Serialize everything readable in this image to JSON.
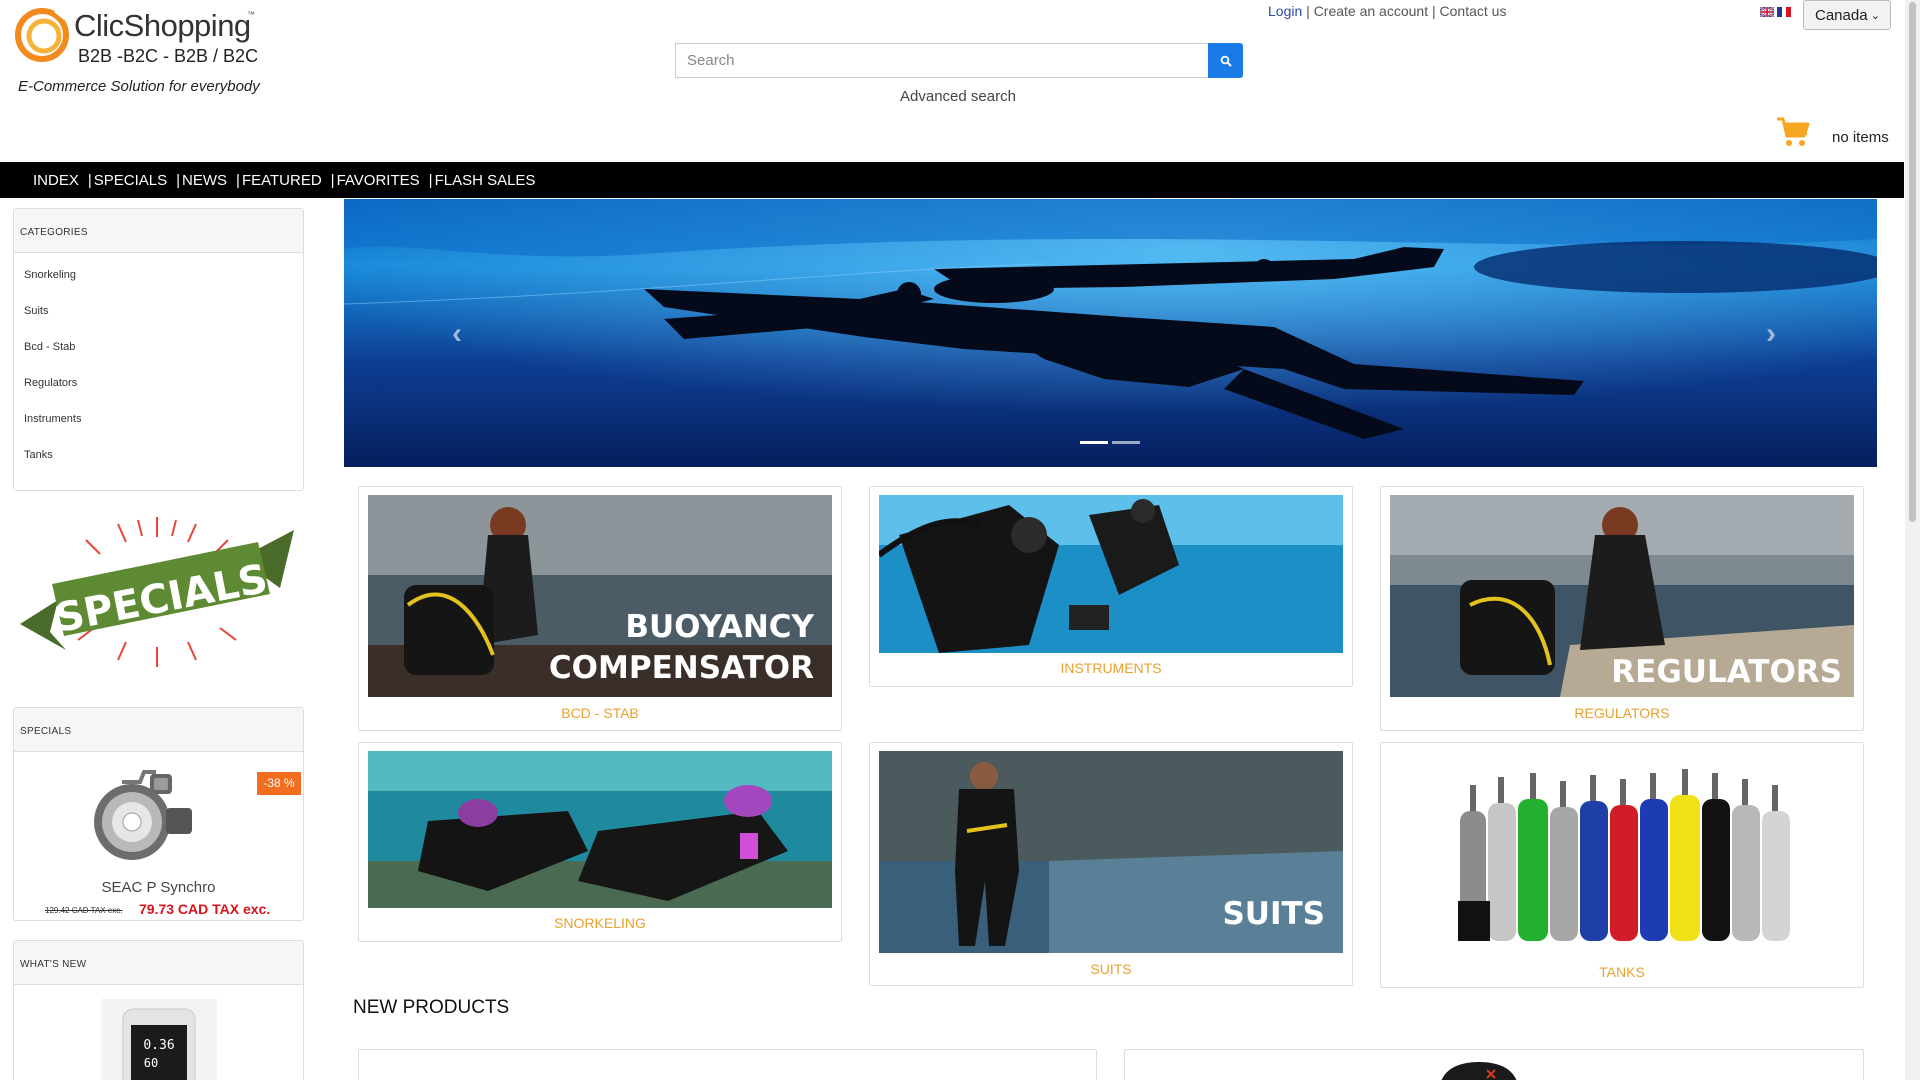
{
  "header": {
    "brand_name": "ClicShopping",
    "brand_tm": "™",
    "brand_subtitle": "B2B -B2C - B2B / B2C",
    "brand_tagline": "E-Commerce Solution for everybody",
    "login_label": "Login",
    "create_account_label": "Create an account",
    "contact_label": "Contact us",
    "separator": " | ",
    "country_select_value": "Canada",
    "search_placeholder": "Search",
    "advanced_search_label": "Advanced search",
    "cart_status": "no items",
    "languages": [
      "en",
      "fr"
    ]
  },
  "nav": {
    "items": [
      {
        "label": "INDEX"
      },
      {
        "label": "SPECIALS"
      },
      {
        "label": "NEWS"
      },
      {
        "label": "FEATURED"
      },
      {
        "label": "FAVORITES"
      },
      {
        "label": "FLASH SALES"
      }
    ]
  },
  "sidebar": {
    "categories_title": "CATEGORIES",
    "categories": [
      "Snorkeling",
      "Suits",
      "Bcd - Stab",
      "Regulators",
      "Instruments",
      "Tanks"
    ],
    "specials_banner_text": "SPECIALS",
    "specials_box_title": "SPECIALS",
    "special_product": {
      "discount_badge": "-38 %",
      "name": "SEAC P Synchro",
      "old_price": "129.42 CAD TAX exc.",
      "new_price": "79.73 CAD TAX exc."
    },
    "whats_new_title": "WHAT'S NEW",
    "whats_new_screen_text": [
      "0.36",
      "60"
    ]
  },
  "slider": {
    "slide_count": 2,
    "active_slide": 1
  },
  "category_tiles": [
    {
      "label": "BCD - STAB",
      "overlay": [
        "BUOYANCY",
        "COMPENSATOR"
      ]
    },
    {
      "label": "INSTRUMENTS",
      "overlay": []
    },
    {
      "label": "REGULATORS",
      "overlay": [
        "REGULATORS"
      ]
    },
    {
      "label": "SNORKELING",
      "overlay": []
    },
    {
      "label": "SUITS",
      "overlay": [
        "SUITS"
      ]
    },
    {
      "label": "TANKS",
      "overlay": []
    }
  ],
  "new_products_title": "NEW PRODUCTS",
  "colors": {
    "accent_blue": "#1a7ae8",
    "nav_bg": "#000000",
    "tile_label": "#e8a12c",
    "price_red": "#d9141c",
    "badge_orange": "#f26d1d",
    "cart_orange": "#f5a623"
  },
  "icons": [
    "search-icon",
    "cart-icon",
    "chevron-down-icon",
    "chevron-left-icon",
    "chevron-right-icon",
    "flag-uk-icon",
    "flag-fr-icon"
  ]
}
